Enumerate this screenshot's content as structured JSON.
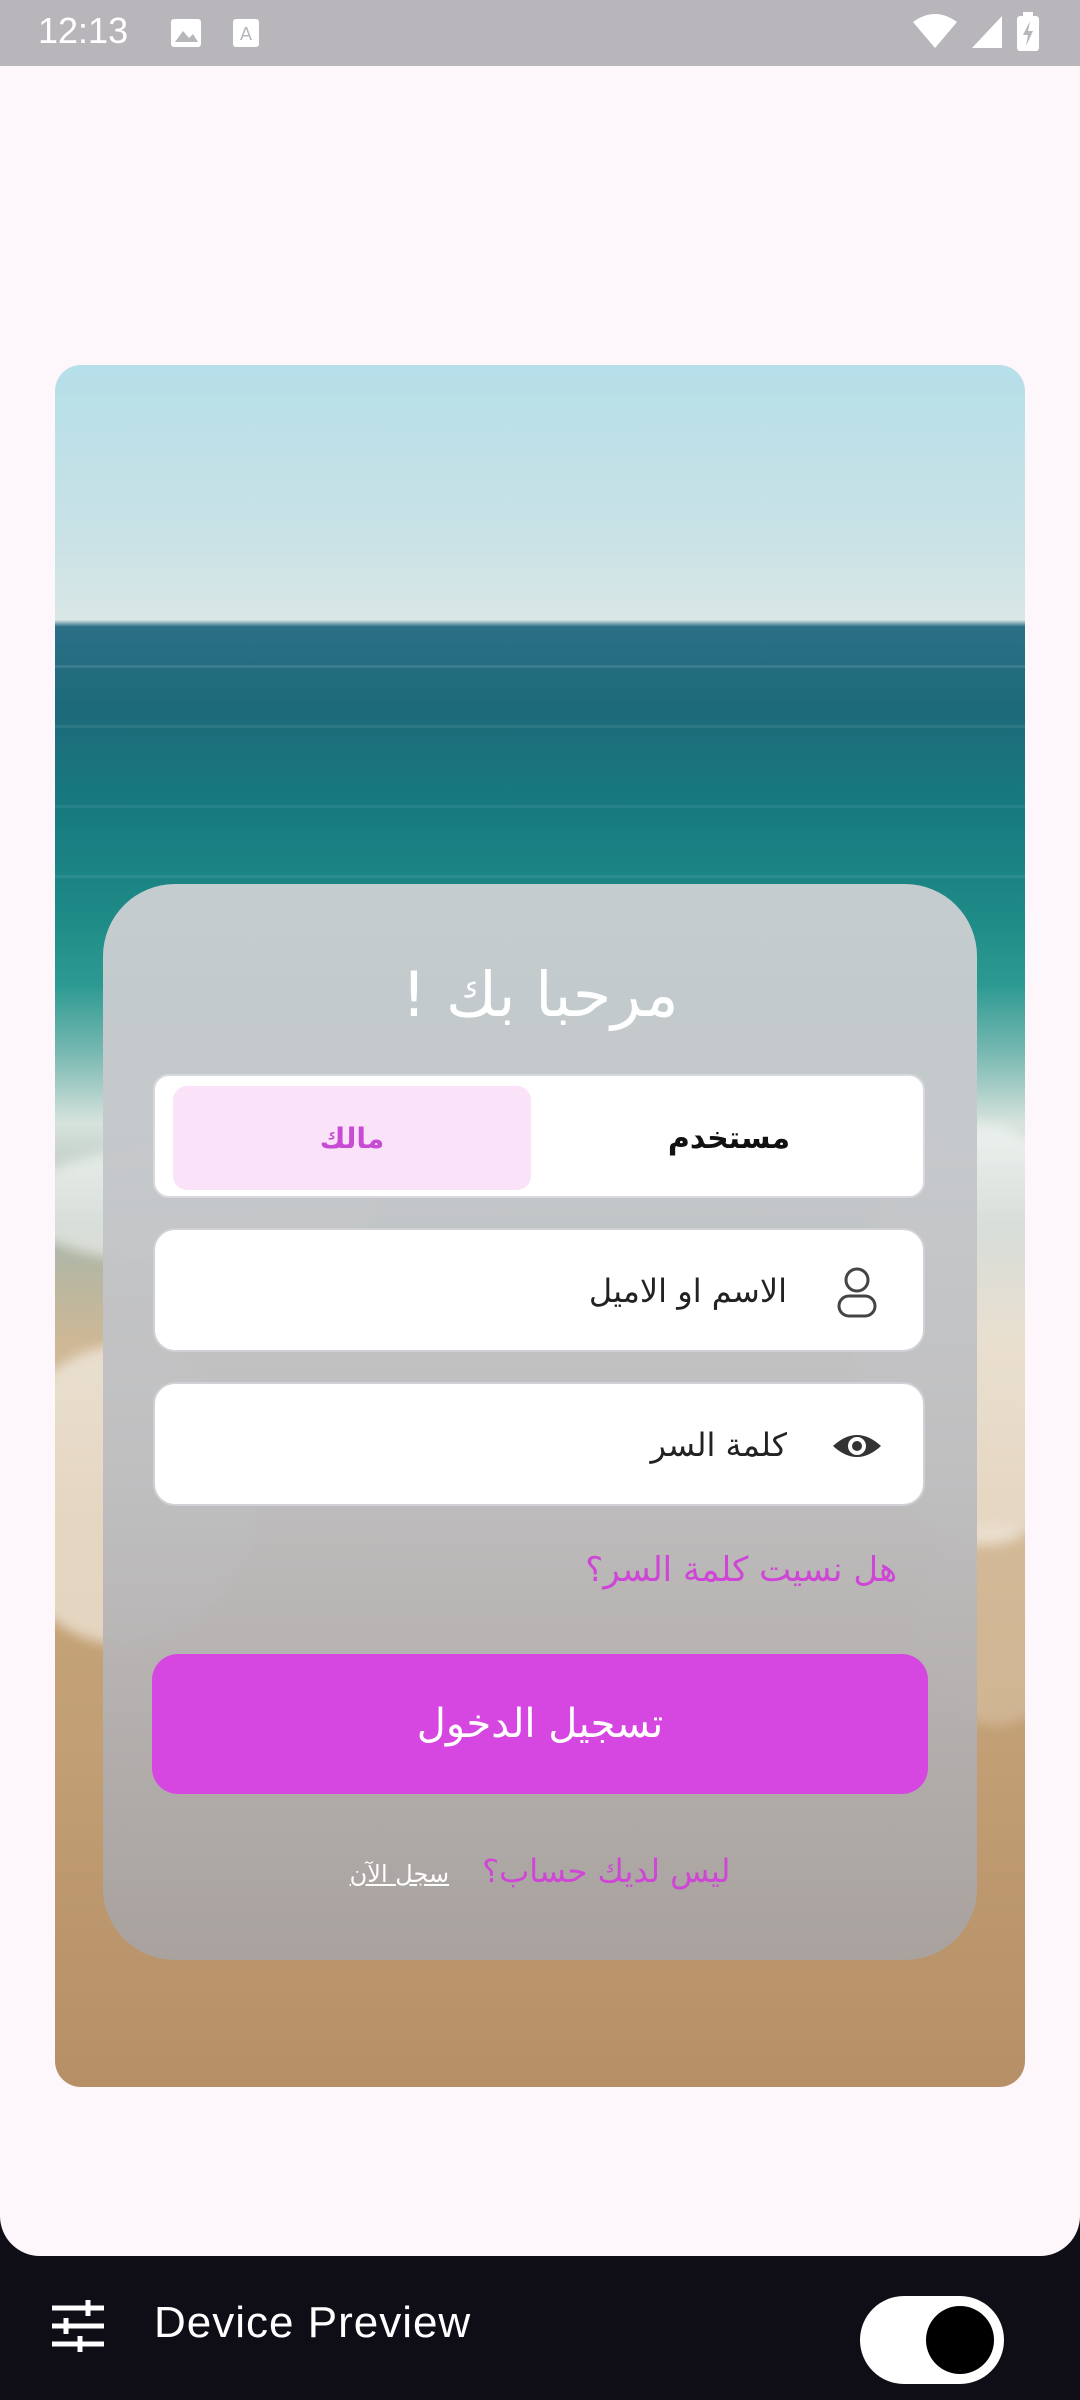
{
  "status_bar": {
    "time": "12:13",
    "icons": [
      "image-icon",
      "text-box-icon",
      "wifi-icon",
      "signal-icon",
      "battery-icon"
    ]
  },
  "login": {
    "title": "مرحبا بك !",
    "segments": {
      "owner_label": "مالك",
      "user_label": "مستخدم",
      "selected": "owner"
    },
    "username_placeholder": "الاسم او الاميل",
    "password_placeholder": "كلمة السر",
    "forgot_password": "هل نسيت كلمة السر؟",
    "login_button": "تسجيل الدخول",
    "no_account": "ليس لديك حساب؟",
    "register_now": "سجل الآن"
  },
  "device_preview": {
    "label": "Device Preview",
    "toggle_on": true
  },
  "colors": {
    "accent": "#d646e0",
    "accent_text": "#cf45d6",
    "segment_selected_bg": "#fae3f9",
    "app_background": "#fdf6fb",
    "bottom_bar": "#0f0e17"
  }
}
